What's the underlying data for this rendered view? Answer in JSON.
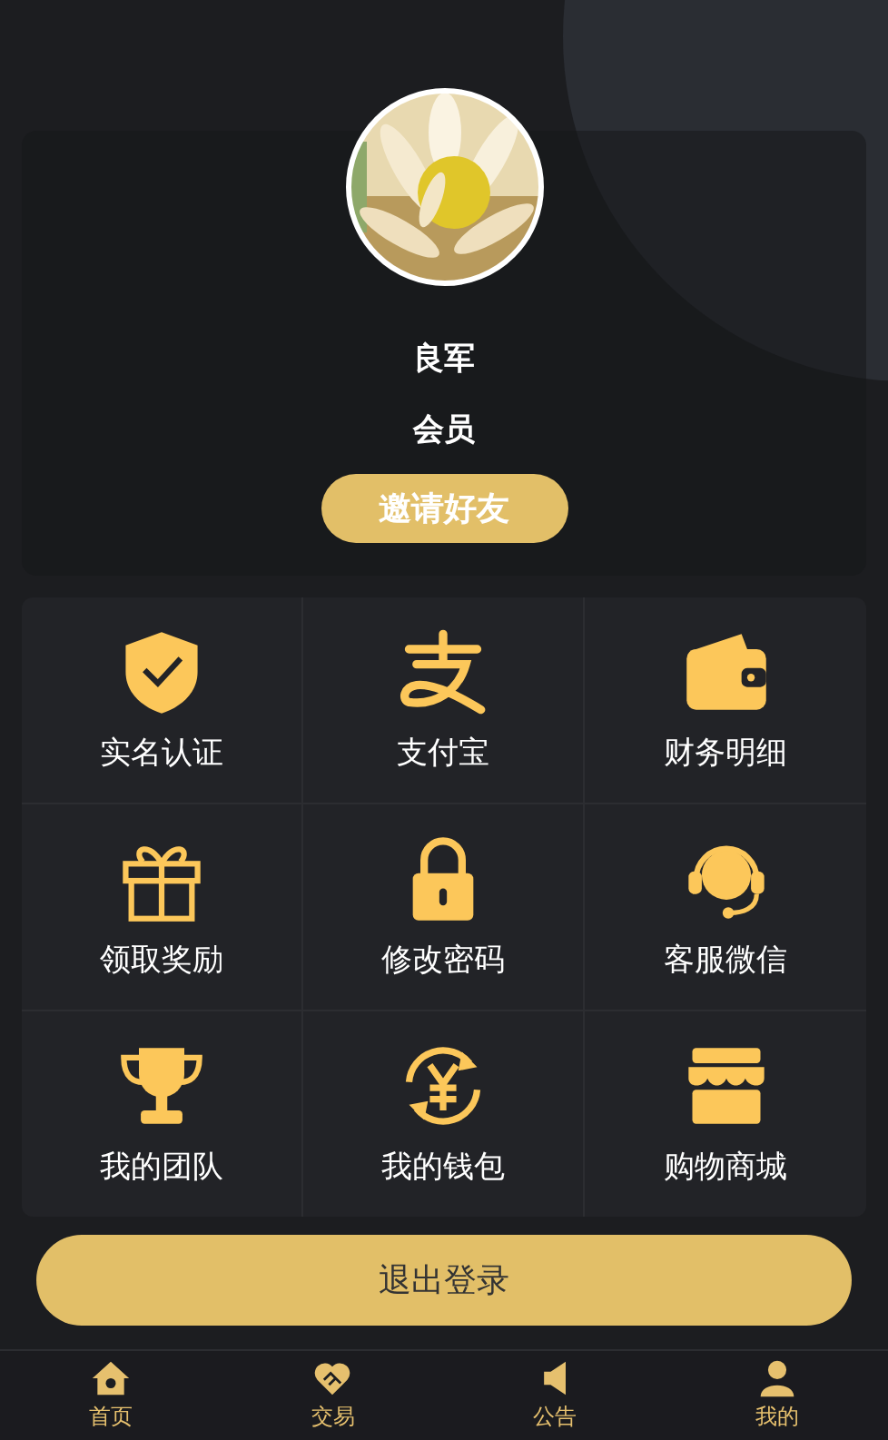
{
  "profile": {
    "name": "良军",
    "level": "会员",
    "invite_button": "邀请好友"
  },
  "menu": [
    {
      "label": "实名认证",
      "kind": "shield"
    },
    {
      "label": "支付宝",
      "kind": "alipay"
    },
    {
      "label": "财务明细",
      "kind": "wallet"
    },
    {
      "label": "领取奖励",
      "kind": "gift"
    },
    {
      "label": "修改密码",
      "kind": "lock"
    },
    {
      "label": "客服微信",
      "kind": "headset"
    },
    {
      "label": "我的团队",
      "kind": "trophy"
    },
    {
      "label": "我的钱包",
      "kind": "yen"
    },
    {
      "label": "购物商城",
      "kind": "shop"
    }
  ],
  "logout_button": "退出登录",
  "tab_bar": [
    {
      "label": "首页",
      "kind": "home"
    },
    {
      "label": "交易",
      "kind": "heart"
    },
    {
      "label": "公告",
      "kind": "speaker"
    },
    {
      "label": "我的",
      "kind": "user"
    }
  ]
}
